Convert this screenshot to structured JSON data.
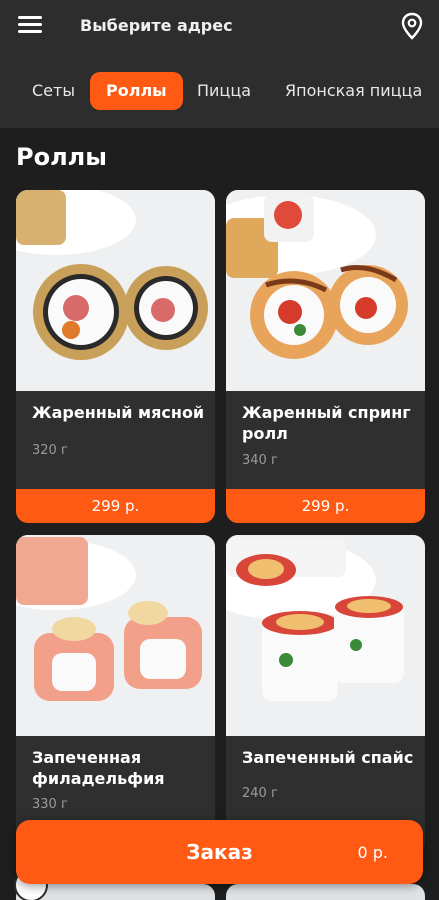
{
  "header": {
    "address_label": "Выберите адрес",
    "menu_icon": "hamburger-menu-icon",
    "location_icon": "map-pin-icon"
  },
  "categories": [
    {
      "label": "Сеты",
      "active": false
    },
    {
      "label": "Роллы",
      "active": true
    },
    {
      "label": "Пицца",
      "active": false
    },
    {
      "label": "Японская пицца",
      "active": false
    }
  ],
  "section": {
    "title": "Роллы"
  },
  "products": [
    {
      "name": "Жаренный мясной",
      "weight": "320 г",
      "price": "299 р."
    },
    {
      "name": "Жаренный спринг ролл",
      "weight": "340 г",
      "price": "299 р."
    },
    {
      "name": "Запеченная филадельфия",
      "weight": "330 г",
      "price": ""
    },
    {
      "name": "Запеченный спайс",
      "weight": "240 г",
      "price": ""
    }
  ],
  "order": {
    "label": "Заказ",
    "total": "0 р."
  },
  "colors": {
    "accent": "#ff5a14",
    "background": "#1e1e1e",
    "bar": "#2d2d2d",
    "card": "#2f2f2f"
  }
}
